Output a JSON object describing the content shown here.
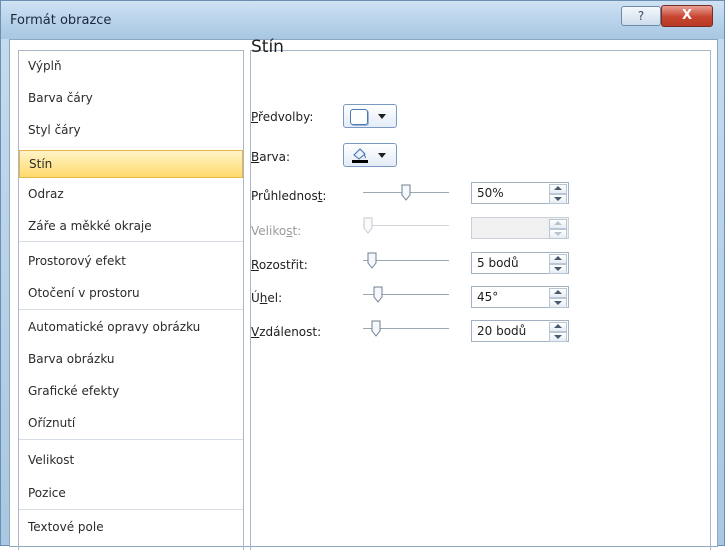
{
  "window": {
    "title": "Formát obrazce",
    "help_glyph": "?",
    "close_glyph": "X"
  },
  "categories": [
    {
      "label": "Výplň"
    },
    {
      "label": "Barva čáry"
    },
    {
      "label": "Styl čáry"
    },
    {
      "label": "Stín",
      "selected": true
    },
    {
      "label": "Odraz"
    },
    {
      "label": "Záře a měkké okraje"
    },
    {
      "label": "Prostorový efekt"
    },
    {
      "label": "Otočení v prostoru"
    },
    {
      "label": "Automatické opravy obrázku"
    },
    {
      "label": "Barva obrázku"
    },
    {
      "label": "Grafické efekty"
    },
    {
      "label": "Oříznutí"
    },
    {
      "label": "Velikost"
    },
    {
      "label": "Pozice"
    },
    {
      "label": "Textové pole"
    }
  ],
  "panel": {
    "heading": "Stín",
    "presets": {
      "pre": "",
      "key": "P",
      "post": "ředvolby:"
    },
    "color": {
      "pre": "",
      "key": "B",
      "post": "arva:"
    },
    "transparency": {
      "pre": "Průhlednos",
      "key": "t",
      "post": ":",
      "value": "50%",
      "level": 0.5
    },
    "size": {
      "pre": "Veliko",
      "key": "s",
      "post": "t:",
      "value": "",
      "disabled": true,
      "level": 0.0
    },
    "blur": {
      "pre": "",
      "key": "R",
      "post": "ozostřit:",
      "value": "5 bodů",
      "level": 0.05
    },
    "angle": {
      "pre": "Ú",
      "key": "h",
      "post": "el:",
      "value": "45°",
      "level": 0.125
    },
    "distance": {
      "pre": "",
      "key": "V",
      "post": "zdálenost:",
      "value": "20 bodů",
      "level": 0.1
    }
  },
  "colors": {
    "accent_selected": "#ffd96b",
    "shadow_color_bar": "#000000"
  },
  "icons": {
    "presets": "shadow-preset-icon",
    "color": "paint-bucket-icon"
  }
}
